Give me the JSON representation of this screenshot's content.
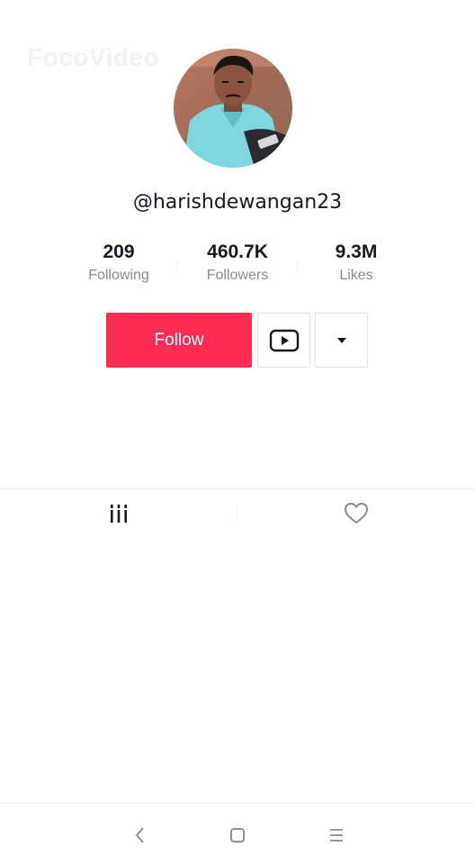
{
  "watermark": "FocoVideo",
  "profile": {
    "username": "@harishdewangan23"
  },
  "stats": [
    {
      "value": "209",
      "label": "Following"
    },
    {
      "value": "460.7K",
      "label": "Followers"
    },
    {
      "value": "9.3M",
      "label": "Likes"
    }
  ],
  "actions": {
    "follow_label": "Follow"
  },
  "tabs": [
    {
      "icon": "videos-grid-icon",
      "selected": true
    },
    {
      "icon": "heart-icon",
      "selected": false
    }
  ],
  "colors": {
    "accent": "#fe2c55",
    "text": "#161823",
    "muted": "#8a8b91"
  }
}
